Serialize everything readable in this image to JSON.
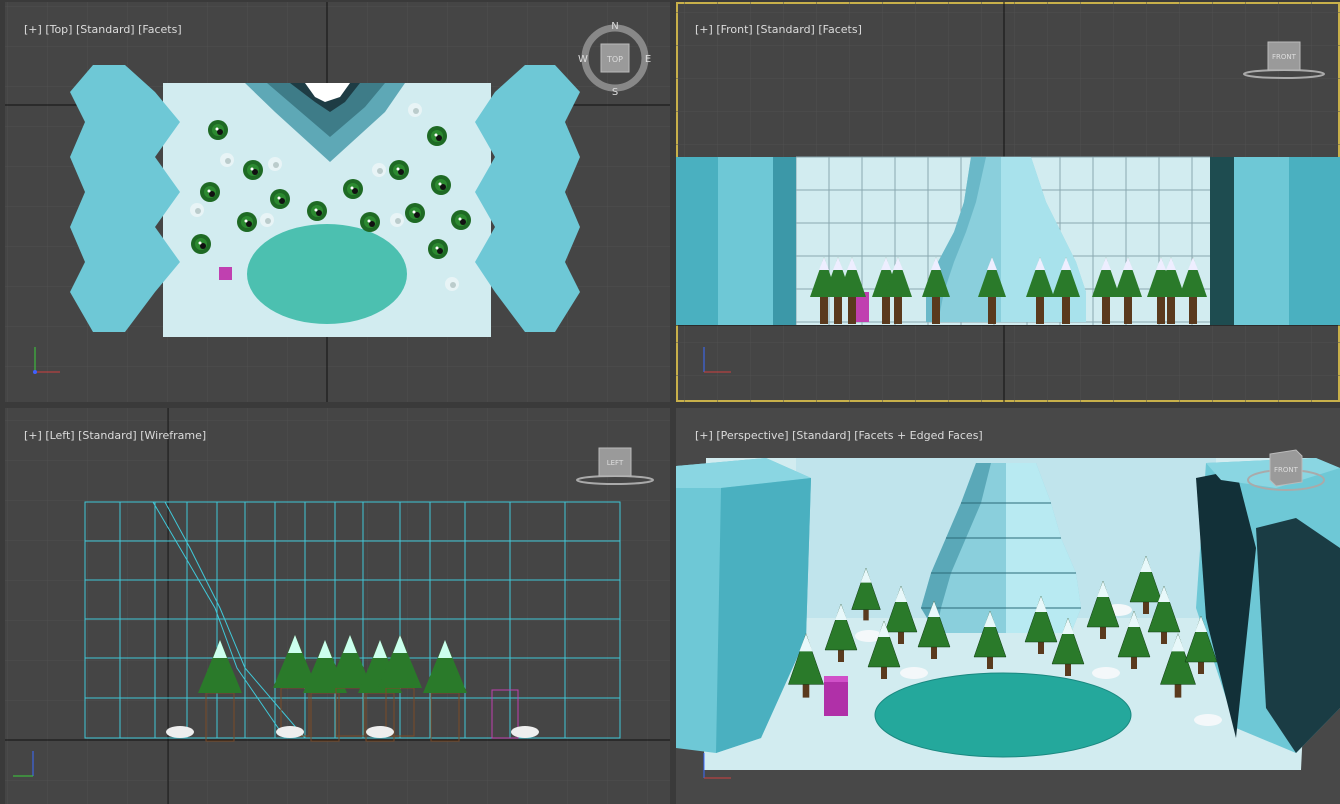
{
  "viewports": {
    "top": {
      "label_parts": [
        "[+]",
        "[Top]",
        "[Standard]",
        "[Facets]"
      ],
      "compass": {
        "n": "N",
        "s": "S",
        "e": "E",
        "w": "W",
        "cube_label": "TOP"
      }
    },
    "front": {
      "label_parts": [
        "[+]",
        "[Front]",
        "[Standard]",
        "[Facets]"
      ],
      "cube_label": "FRONT",
      "active": true
    },
    "left": {
      "label_parts": [
        "[+]",
        "[Left]",
        "[Standard]",
        "[Wireframe]"
      ],
      "cube_label": "LEFT"
    },
    "perspective": {
      "label_parts": [
        "[+]",
        "[Perspective]",
        "[Standard]",
        "[Facets + Edged Faces]"
      ],
      "cube_label": "FRONT"
    }
  },
  "axis": {
    "x": "x",
    "y": "y",
    "z": "z"
  },
  "colors": {
    "viewport_bg": "#454545",
    "grid": "#525252",
    "ice": "#6ec8d6",
    "snow": "#d2ecf0",
    "pond": "#4cc0b0",
    "tree": "#2a7a2a",
    "gift": "#c040b0",
    "active_border": "#c8b04a"
  }
}
